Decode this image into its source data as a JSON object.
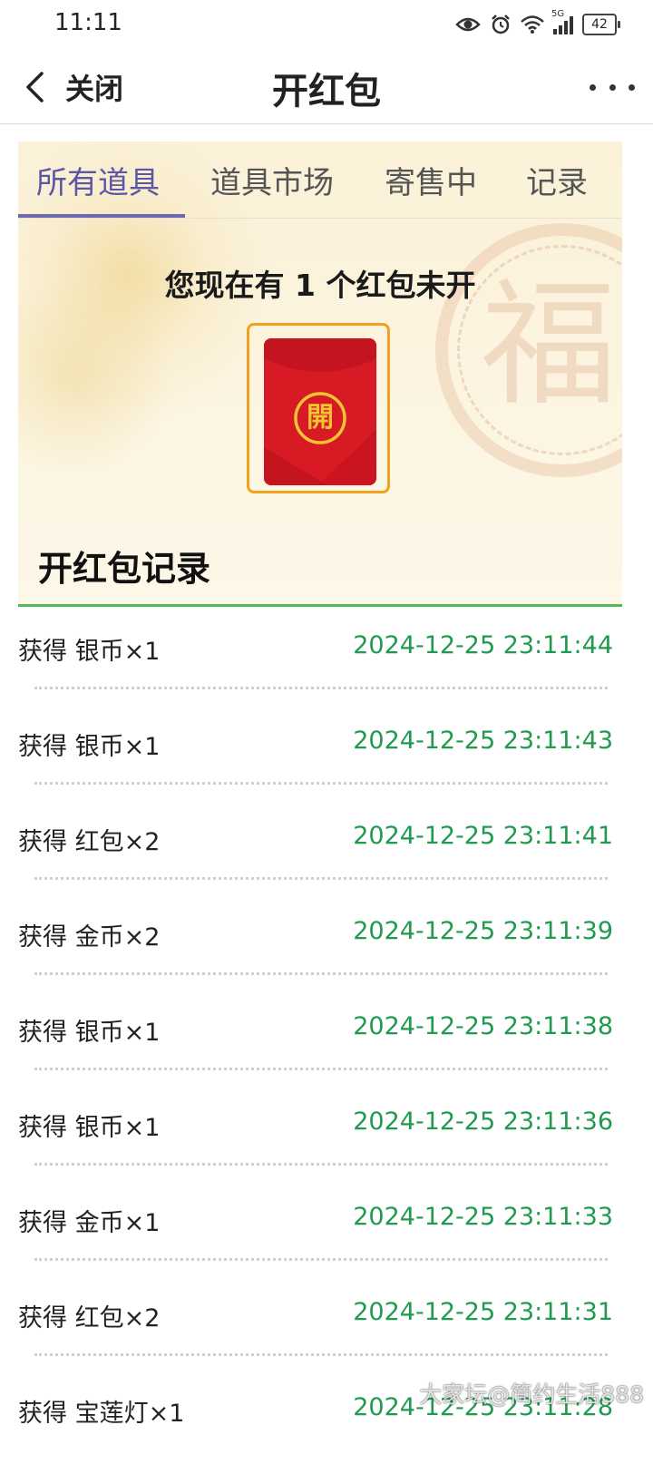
{
  "status_bar": {
    "time": "11:11",
    "signal_label": "5G",
    "battery": "42"
  },
  "nav": {
    "back_label": "关闭",
    "title": "开红包"
  },
  "tabs": [
    {
      "label": "所有道具",
      "active": true
    },
    {
      "label": "道具市场",
      "active": false
    },
    {
      "label": "寄售中",
      "active": false
    },
    {
      "label": "记录",
      "active": false
    }
  ],
  "banner": {
    "unopened_text": "您现在有 1 个红包未开",
    "envelope_char": "開",
    "background_char": "福"
  },
  "records": {
    "title": "开红包记录",
    "items": [
      {
        "item": "获得 银币×1",
        "time": "2024-12-25 23:11:44"
      },
      {
        "item": "获得 银币×1",
        "time": "2024-12-25 23:11:43"
      },
      {
        "item": "获得 红包×2",
        "time": "2024-12-25 23:11:41"
      },
      {
        "item": "获得 金币×2",
        "time": "2024-12-25 23:11:39"
      },
      {
        "item": "获得 银币×1",
        "time": "2024-12-25 23:11:38"
      },
      {
        "item": "获得 银币×1",
        "time": "2024-12-25 23:11:36"
      },
      {
        "item": "获得 金币×1",
        "time": "2024-12-25 23:11:33"
      },
      {
        "item": "获得 红包×2",
        "time": "2024-12-25 23:11:31"
      },
      {
        "item": "获得 宝莲灯×1",
        "time": "2024-12-25 23:11:28"
      }
    ]
  },
  "watermark": "大家坛@简约生活888",
  "colors": {
    "tab_active": "#5b57a6",
    "timestamp": "#1f9a4e",
    "envelope_red": "#d81a25",
    "envelope_border": "#f0a21e",
    "divider_green": "#52b85a"
  }
}
